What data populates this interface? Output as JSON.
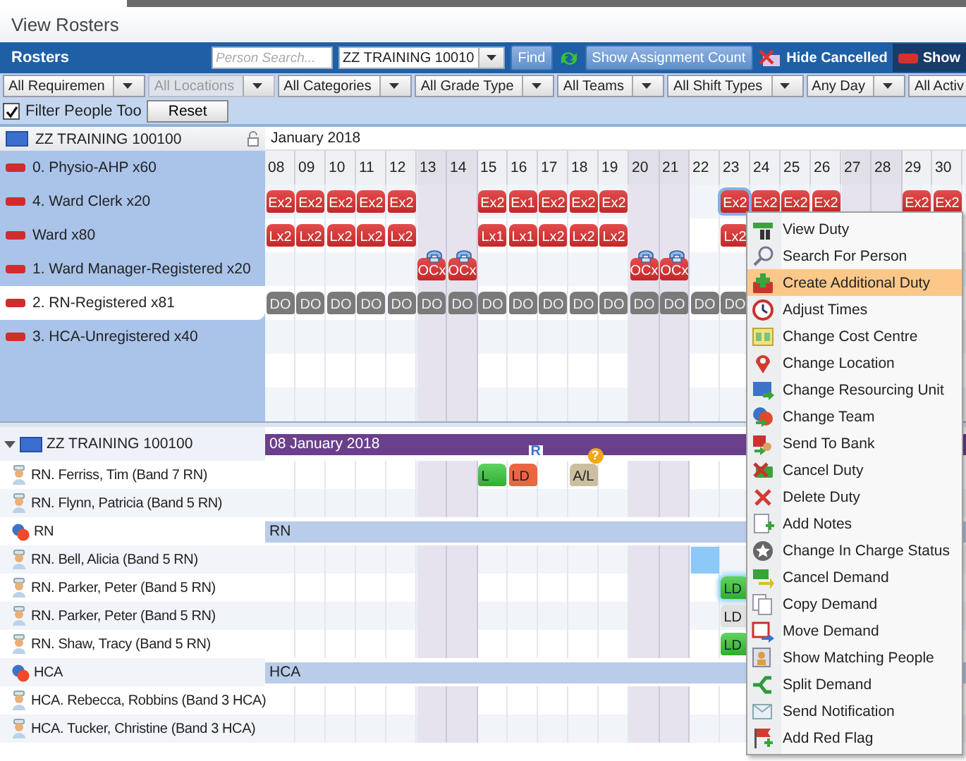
{
  "page_title": "View Rosters",
  "toolbar": {
    "title": "Rosters",
    "search": {
      "placeholder": "Person Search..."
    },
    "unit_select": {
      "value": "ZZ TRAINING 10010"
    },
    "find_button": "Find",
    "assignment_button": "Show Assignment Count",
    "hide_cancelled": "Hide Cancelled",
    "show_button": "Show"
  },
  "filters": [
    {
      "value": "All Requiremen",
      "disabled": false
    },
    {
      "value": "All Locations",
      "disabled": true
    },
    {
      "value": "All Categories",
      "disabled": false
    },
    {
      "value": "All Grade Type",
      "disabled": false
    },
    {
      "value": "All Teams",
      "disabled": false
    },
    {
      "value": "All Shift Types",
      "disabled": false
    },
    {
      "value": "Any Day",
      "disabled": false
    },
    {
      "value": "All Activ",
      "disabled": false
    }
  ],
  "filter_people": {
    "label": "Filter People Too",
    "checked": true
  },
  "reset_button": "Reset",
  "requirements": {
    "unit": "ZZ TRAINING 100100",
    "month": "January 2018",
    "days": [
      {
        "label": "08",
        "weekend": false
      },
      {
        "label": "09",
        "weekend": false
      },
      {
        "label": "10",
        "weekend": false
      },
      {
        "label": "11",
        "weekend": false
      },
      {
        "label": "12",
        "weekend": false
      },
      {
        "label": "13",
        "weekend": true
      },
      {
        "label": "14",
        "weekend": true
      },
      {
        "label": "15",
        "weekend": false
      },
      {
        "label": "16",
        "weekend": false
      },
      {
        "label": "17",
        "weekend": false
      },
      {
        "label": "18",
        "weekend": false
      },
      {
        "label": "19",
        "weekend": false
      },
      {
        "label": "20",
        "weekend": true
      },
      {
        "label": "21",
        "weekend": true
      },
      {
        "label": "22",
        "weekend": false
      },
      {
        "label": "23",
        "weekend": false
      },
      {
        "label": "24",
        "weekend": false
      },
      {
        "label": "25",
        "weekend": false
      },
      {
        "label": "26",
        "weekend": false
      },
      {
        "label": "27",
        "weekend": true
      },
      {
        "label": "28",
        "weekend": true
      },
      {
        "label": "29",
        "weekend": false
      },
      {
        "label": "30",
        "weekend": false
      }
    ],
    "items": [
      {
        "label": "0. Physio-AHP x60",
        "selected": false
      },
      {
        "label": "4. Ward Clerk x20",
        "selected": false,
        "shifts": [
          {
            "label": "Ex2",
            "kind": "duty"
          },
          {
            "label": "Ex2",
            "kind": "duty"
          },
          {
            "label": "Ex2",
            "kind": "duty"
          },
          {
            "label": "Ex2",
            "kind": "duty"
          },
          {
            "label": "Ex2",
            "kind": "duty"
          },
          {
            "kind": "empty"
          },
          {
            "kind": "empty"
          },
          {
            "label": "Ex2",
            "kind": "duty"
          },
          {
            "label": "Ex1",
            "kind": "duty"
          },
          {
            "label": "Ex2",
            "kind": "duty"
          },
          {
            "label": "Ex2",
            "kind": "duty"
          },
          {
            "label": "Ex2",
            "kind": "duty"
          },
          {
            "kind": "empty"
          },
          {
            "kind": "empty"
          },
          {
            "kind": "empty"
          },
          {
            "label": "Ex2",
            "kind": "duty-focus"
          },
          {
            "label": "Ex2",
            "kind": "duty"
          },
          {
            "label": "Ex2",
            "kind": "duty"
          },
          {
            "label": "Ex2",
            "kind": "duty"
          },
          {
            "kind": "empty"
          },
          {
            "kind": "empty"
          },
          {
            "label": "Ex2",
            "kind": "duty"
          },
          {
            "label": "Ex2",
            "kind": "duty"
          }
        ]
      },
      {
        "label": "Ward  x80",
        "selected": false,
        "shifts": [
          {
            "label": "Lx2",
            "kind": "duty"
          },
          {
            "label": "Lx2",
            "kind": "duty"
          },
          {
            "label": "Lx2",
            "kind": "duty"
          },
          {
            "label": "Lx2",
            "kind": "duty"
          },
          {
            "label": "Lx2",
            "kind": "duty"
          },
          {
            "kind": "empty"
          },
          {
            "kind": "empty"
          },
          {
            "label": "Lx1",
            "kind": "duty"
          },
          {
            "label": "Lx1",
            "kind": "duty"
          },
          {
            "label": "Lx2",
            "kind": "duty"
          },
          {
            "label": "Lx2",
            "kind": "duty"
          },
          {
            "label": "Lx2",
            "kind": "duty"
          },
          {
            "kind": "empty"
          },
          {
            "kind": "empty"
          },
          {
            "kind": "empty"
          },
          {
            "label": "Lx2",
            "kind": "duty"
          }
        ]
      },
      {
        "label": "1. Ward Manager-Registered x20",
        "selected": false,
        "shifts": [
          {
            "kind": "empty"
          },
          {
            "kind": "empty"
          },
          {
            "kind": "empty"
          },
          {
            "kind": "empty"
          },
          {
            "kind": "empty"
          },
          {
            "label": "OCx",
            "kind": "oncall"
          },
          {
            "label": "OCx",
            "kind": "oncall"
          },
          {
            "kind": "empty"
          },
          {
            "kind": "empty"
          },
          {
            "kind": "empty"
          },
          {
            "kind": "empty"
          },
          {
            "kind": "empty"
          },
          {
            "label": "OCx",
            "kind": "oncall"
          },
          {
            "label": "OCx",
            "kind": "oncall"
          }
        ]
      },
      {
        "label": "2. RN-Registered x81",
        "selected": true,
        "shifts": [
          {
            "label": "DO",
            "kind": "off"
          },
          {
            "label": "DO",
            "kind": "off"
          },
          {
            "label": "DO",
            "kind": "off"
          },
          {
            "label": "DO",
            "kind": "off"
          },
          {
            "label": "DO",
            "kind": "off"
          },
          {
            "label": "DO",
            "kind": "off"
          },
          {
            "label": "DO",
            "kind": "off"
          },
          {
            "label": "DO",
            "kind": "off"
          },
          {
            "label": "DO",
            "kind": "off"
          },
          {
            "label": "DO",
            "kind": "off"
          },
          {
            "label": "DO",
            "kind": "off"
          },
          {
            "label": "DO",
            "kind": "off"
          },
          {
            "label": "DO",
            "kind": "off"
          },
          {
            "label": "DO",
            "kind": "off"
          },
          {
            "label": "DO",
            "kind": "off"
          },
          {
            "label": "DO",
            "kind": "off"
          }
        ]
      },
      {
        "label": "3. HCA-Unregistered x40",
        "selected": false
      }
    ]
  },
  "people": {
    "unit": "ZZ TRAINING 100100",
    "expanded": true,
    "date_bar": "08 January 2018",
    "rows": [
      {
        "kind": "person",
        "label": "RN. Ferriss, Tim (Band 7 RN)",
        "shifts": [
          {
            "kind": "empty"
          },
          {
            "kind": "empty"
          },
          {
            "kind": "empty"
          },
          {
            "kind": "empty"
          },
          {
            "kind": "empty"
          },
          {
            "kind": "empty"
          },
          {
            "kind": "empty"
          },
          {
            "label": "L",
            "kind": "green"
          },
          {
            "label": "LD",
            "kind": "orange",
            "badge": "R"
          },
          {
            "kind": "empty"
          },
          {
            "label": "A/L",
            "kind": "leave",
            "badge": "?"
          }
        ]
      },
      {
        "kind": "person",
        "label": "RN. Flynn, Patricia (Band 5 RN)"
      },
      {
        "kind": "team",
        "label": "RN",
        "bar": "RN"
      },
      {
        "kind": "person",
        "label": "RN. Bell, Alicia (Band 5 RN)",
        "shifts": [
          {
            "kind": "empty"
          },
          {
            "kind": "empty"
          },
          {
            "kind": "empty"
          },
          {
            "kind": "empty"
          },
          {
            "kind": "empty"
          },
          {
            "kind": "empty"
          },
          {
            "kind": "empty"
          },
          {
            "kind": "empty"
          },
          {
            "kind": "empty"
          },
          {
            "kind": "empty"
          },
          {
            "kind": "empty"
          },
          {
            "kind": "empty"
          },
          {
            "kind": "empty"
          },
          {
            "kind": "empty"
          },
          {
            "kind": "request"
          }
        ]
      },
      {
        "kind": "person",
        "label": "RN. Parker, Peter (Band 5 RN)",
        "shifts": [
          {
            "kind": "empty"
          },
          {
            "kind": "empty"
          },
          {
            "kind": "empty"
          },
          {
            "kind": "empty"
          },
          {
            "kind": "empty"
          },
          {
            "kind": "empty"
          },
          {
            "kind": "empty"
          },
          {
            "kind": "empty"
          },
          {
            "kind": "empty"
          },
          {
            "kind": "empty"
          },
          {
            "kind": "empty"
          },
          {
            "kind": "empty"
          },
          {
            "kind": "empty"
          },
          {
            "kind": "empty"
          },
          {
            "kind": "empty"
          },
          {
            "label": "LD",
            "kind": "green-focus"
          }
        ]
      },
      {
        "kind": "person",
        "label": "RN. Parker, Peter (Band 5 RN)",
        "shifts": [
          {
            "kind": "empty"
          },
          {
            "kind": "empty"
          },
          {
            "kind": "empty"
          },
          {
            "kind": "empty"
          },
          {
            "kind": "empty"
          },
          {
            "kind": "empty"
          },
          {
            "kind": "empty"
          },
          {
            "kind": "empty"
          },
          {
            "kind": "empty"
          },
          {
            "kind": "empty"
          },
          {
            "kind": "empty"
          },
          {
            "kind": "empty"
          },
          {
            "kind": "empty"
          },
          {
            "kind": "empty"
          },
          {
            "kind": "empty"
          },
          {
            "label": "LD",
            "kind": "grey"
          }
        ]
      },
      {
        "kind": "person",
        "label": "RN. Shaw, Tracy (Band 5 RN)",
        "shifts": [
          {
            "kind": "empty"
          },
          {
            "kind": "empty"
          },
          {
            "kind": "empty"
          },
          {
            "kind": "empty"
          },
          {
            "kind": "empty"
          },
          {
            "kind": "empty"
          },
          {
            "kind": "empty"
          },
          {
            "kind": "empty"
          },
          {
            "kind": "empty"
          },
          {
            "kind": "empty"
          },
          {
            "kind": "empty"
          },
          {
            "kind": "empty"
          },
          {
            "kind": "empty"
          },
          {
            "kind": "empty"
          },
          {
            "kind": "empty"
          },
          {
            "label": "LD",
            "kind": "green"
          }
        ]
      },
      {
        "kind": "team",
        "label": "HCA",
        "bar": "HCA"
      },
      {
        "kind": "person",
        "label": "HCA. Rebecca, Robbins (Band 3 HCA)"
      },
      {
        "kind": "person",
        "label": "HCA. Tucker, Christine (Band 3 HCA)"
      }
    ]
  },
  "context_menu": [
    {
      "label": "View Duty",
      "selected": false
    },
    {
      "label": "Search For Person",
      "selected": false
    },
    {
      "label": "Create Additional Duty",
      "selected": true
    },
    {
      "label": "Adjust Times",
      "selected": false
    },
    {
      "label": "Change Cost Centre",
      "selected": false
    },
    {
      "label": "Change Location",
      "selected": false
    },
    {
      "label": "Change Resourcing Unit",
      "selected": false
    },
    {
      "label": "Change Team",
      "selected": false
    },
    {
      "label": "Send To Bank",
      "selected": false
    },
    {
      "label": "Cancel Duty",
      "selected": false
    },
    {
      "label": "Delete Duty",
      "selected": false
    },
    {
      "label": "Add Notes",
      "selected": false
    },
    {
      "label": "Change In Charge Status",
      "selected": false
    },
    {
      "label": "Cancel Demand",
      "selected": false
    },
    {
      "label": "Copy Demand",
      "selected": false
    },
    {
      "label": "Move Demand",
      "selected": false
    },
    {
      "label": "Show Matching People",
      "selected": false
    },
    {
      "label": "Split Demand",
      "selected": false
    },
    {
      "label": "Send Notification",
      "selected": false
    },
    {
      "label": "Add Red Flag",
      "selected": false
    }
  ]
}
